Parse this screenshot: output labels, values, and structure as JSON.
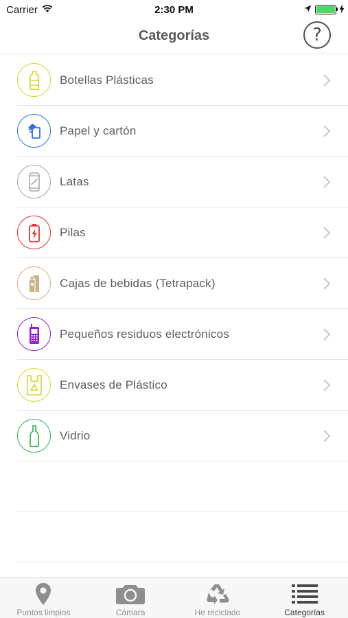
{
  "status_bar": {
    "carrier": "Carrier",
    "time": "2:30 PM",
    "battery_level": 1.0,
    "battery_color": "#4cd964"
  },
  "nav": {
    "title": "Categorías",
    "help_label": "?"
  },
  "categories": [
    {
      "label": "Botellas Plásticas",
      "icon": "plastic-bottle-icon",
      "color": "#d6d62a"
    },
    {
      "label": "Papel y cartón",
      "icon": "paper-icon",
      "color": "#2f6fe0"
    },
    {
      "label": "Latas",
      "icon": "can-icon",
      "color": "#a6a6a6"
    },
    {
      "label": "Pilas",
      "icon": "battery-icon",
      "color": "#e63232"
    },
    {
      "label": "Cajas de bebidas (Tetrapack)",
      "icon": "tetrapack-icon",
      "color": "#cbb28a"
    },
    {
      "label": "Pequeños residuos electrónicos",
      "icon": "phone-icon",
      "color": "#8f1fd6"
    },
    {
      "label": "Envases de Plástico",
      "icon": "plastic-bag-icon",
      "color": "#d6d62a"
    },
    {
      "label": "Vidrio",
      "icon": "glass-bottle-icon",
      "color": "#2fae52"
    }
  ],
  "tabs": [
    {
      "label": "Puntos limpios",
      "icon": "map-pin-icon",
      "active": false
    },
    {
      "label": "Cámara",
      "icon": "camera-icon",
      "active": false
    },
    {
      "label": "He reciclado",
      "icon": "recycle-icon",
      "active": false
    },
    {
      "label": "Categorías",
      "icon": "list-icon",
      "active": true
    }
  ]
}
